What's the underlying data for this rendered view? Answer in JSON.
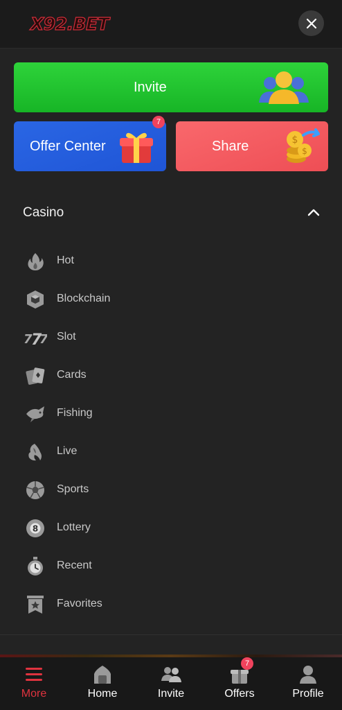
{
  "header": {
    "logo_text": "X92.BET",
    "close_icon": "close-icon"
  },
  "actions": {
    "invite_label": "Invite",
    "offer_label": "Offer Center",
    "offer_badge": "7",
    "share_label": "Share"
  },
  "section": {
    "title": "Casino",
    "expanded": true
  },
  "menu": [
    {
      "label": "Hot",
      "icon": "flame-icon"
    },
    {
      "label": "Blockchain",
      "icon": "blockchain-cube-icon"
    },
    {
      "label": "Slot",
      "icon": "slot-777-icon"
    },
    {
      "label": "Cards",
      "icon": "cards-icon"
    },
    {
      "label": "Fishing",
      "icon": "fish-icon"
    },
    {
      "label": "Live",
      "icon": "live-dealer-icon"
    },
    {
      "label": "Sports",
      "icon": "soccer-ball-icon"
    },
    {
      "label": "Lottery",
      "icon": "lottery-ball-icon"
    },
    {
      "label": "Recent",
      "icon": "stopwatch-icon"
    },
    {
      "label": "Favorites",
      "icon": "bookmark-star-icon"
    }
  ],
  "tabbar": {
    "items": [
      {
        "label": "More",
        "icon": "menu-icon",
        "active": true
      },
      {
        "label": "Home",
        "icon": "home-icon"
      },
      {
        "label": "Invite",
        "icon": "users-icon"
      },
      {
        "label": "Offers",
        "icon": "gift-icon",
        "badge": "7"
      },
      {
        "label": "Profile",
        "icon": "profile-icon"
      }
    ]
  },
  "colors": {
    "active_tab": "#e0333f",
    "invite_green": "#22c430",
    "offer_blue": "#2561df",
    "share_red": "#f45a60",
    "badge": "#f0435d"
  }
}
